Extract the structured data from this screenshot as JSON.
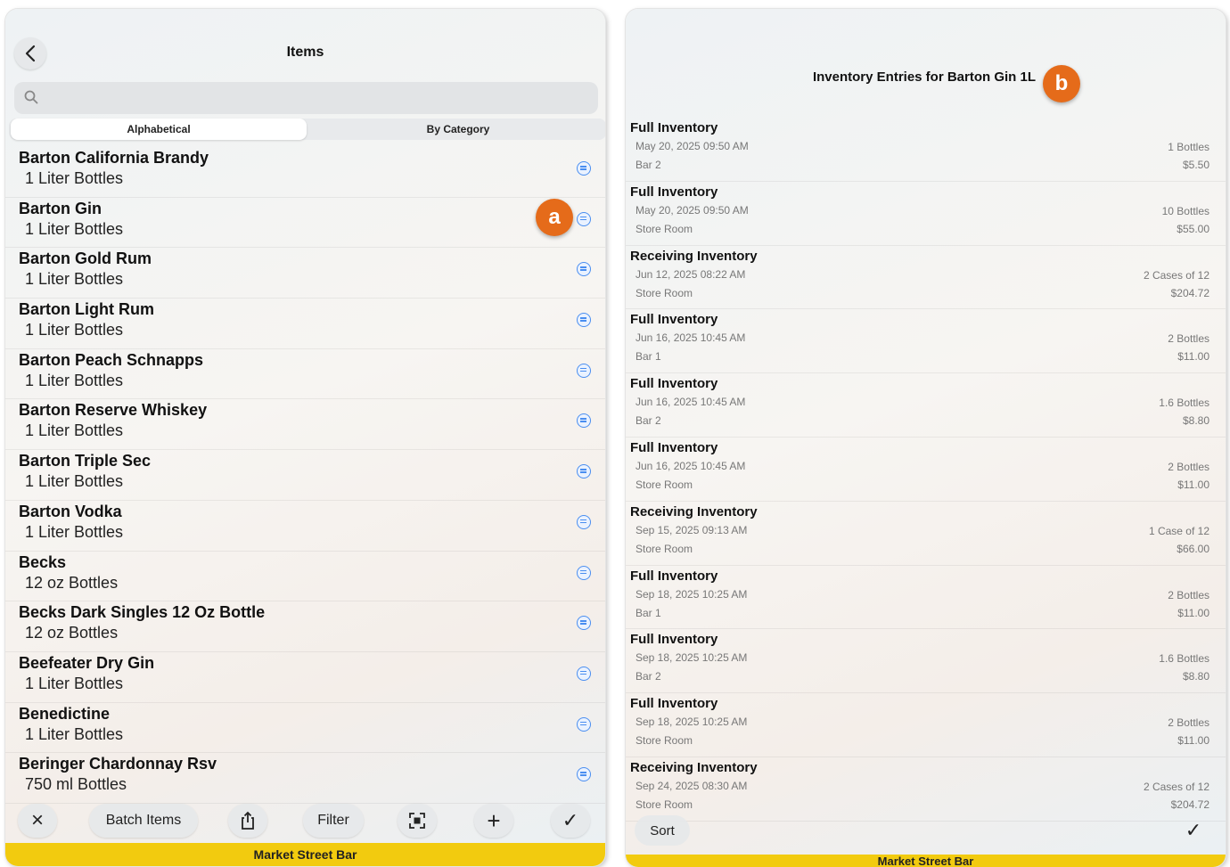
{
  "items_panel": {
    "title": "Items",
    "search_placeholder": "",
    "segments": [
      "Alphabetical",
      "By Category"
    ],
    "items": [
      {
        "name": "Barton California Brandy",
        "size": "1 Liter Bottles"
      },
      {
        "name": "Barton Gin",
        "size": "1 Liter Bottles"
      },
      {
        "name": "Barton Gold Rum",
        "size": "1 Liter Bottles"
      },
      {
        "name": "Barton Light Rum",
        "size": "1 Liter Bottles"
      },
      {
        "name": "Barton Peach Schnapps",
        "size": "1 Liter Bottles"
      },
      {
        "name": "Barton Reserve Whiskey",
        "size": "1 Liter Bottles"
      },
      {
        "name": "Barton Triple Sec",
        "size": "1 Liter Bottles"
      },
      {
        "name": "Barton Vodka",
        "size": "1 Liter Bottles"
      },
      {
        "name": "Becks",
        "size": "12 oz Bottles"
      },
      {
        "name": "Becks Dark Singles 12 Oz Bottle",
        "size": "12 oz Bottles"
      },
      {
        "name": "Beefeater Dry Gin",
        "size": "1 Liter Bottles"
      },
      {
        "name": "Benedictine",
        "size": "1 Liter Bottles"
      },
      {
        "name": "Beringer Chardonnay Rsv",
        "size": "750 ml Bottles"
      }
    ],
    "toolbar": {
      "close_icon": "×",
      "batch_label": "Batch Items",
      "share_icon": "share-icon",
      "filter_label": "Filter",
      "scan_icon": "scan-icon",
      "add_icon": "+",
      "done_icon": "✓"
    },
    "footer": "Market Street Bar",
    "badge": "a"
  },
  "entries_panel": {
    "title": "Inventory Entries for Barton Gin 1L",
    "badge": "b",
    "entries": [
      {
        "type": "Full Inventory",
        "date": "May 20, 2025 09:50 AM",
        "location": "Bar 2",
        "qty": "1 Bottles",
        "cost": "$5.50"
      },
      {
        "type": "Full Inventory",
        "date": "May 20, 2025 09:50 AM",
        "location": "Store Room",
        "qty": "10 Bottles",
        "cost": "$55.00"
      },
      {
        "type": "Receiving Inventory",
        "date": "Jun 12, 2025 08:22 AM",
        "location": "Store Room",
        "qty": "2 Cases of 12",
        "cost": "$204.72"
      },
      {
        "type": "Full Inventory",
        "date": "Jun 16, 2025 10:45 AM",
        "location": "Bar 1",
        "qty": "2 Bottles",
        "cost": "$11.00"
      },
      {
        "type": "Full Inventory",
        "date": "Jun 16, 2025 10:45 AM",
        "location": "Bar 2",
        "qty": "1.6 Bottles",
        "cost": "$8.80"
      },
      {
        "type": "Full Inventory",
        "date": "Jun 16, 2025 10:45 AM",
        "location": "Store Room",
        "qty": "2 Bottles",
        "cost": "$11.00"
      },
      {
        "type": "Receiving Inventory",
        "date": "Sep 15, 2025 09:13 AM",
        "location": "Store Room",
        "qty": "1 Case of 12",
        "cost": "$66.00"
      },
      {
        "type": "Full Inventory",
        "date": "Sep 18, 2025 10:25 AM",
        "location": "Bar 1",
        "qty": "2 Bottles",
        "cost": "$11.00"
      },
      {
        "type": "Full Inventory",
        "date": "Sep 18, 2025 10:25 AM",
        "location": "Bar 2",
        "qty": "1.6 Bottles",
        "cost": "$8.80"
      },
      {
        "type": "Full Inventory",
        "date": "Sep 18, 2025 10:25 AM",
        "location": "Store Room",
        "qty": "2 Bottles",
        "cost": "$11.00"
      },
      {
        "type": "Receiving Inventory",
        "date": "Sep 24, 2025 08:30 AM",
        "location": "Store Room",
        "qty": "2 Cases of 12",
        "cost": "$204.72"
      }
    ],
    "sort_label": "Sort",
    "done_icon": "✓",
    "footer": "Market Street Bar"
  },
  "colors": {
    "accent_badge": "#e56b1a",
    "footer_yellow": "#f2cb0f",
    "info_blue": "#4a8ef0"
  }
}
